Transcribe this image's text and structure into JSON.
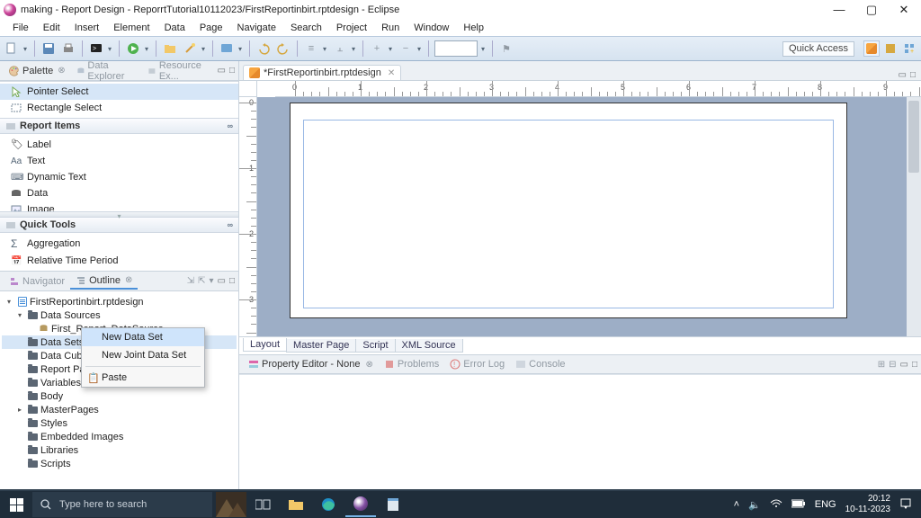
{
  "window": {
    "title": "making - Report Design - ReporrtTutorial10112023/FirstReportinbirt.rptdesign - Eclipse",
    "controls": {
      "min": "—",
      "max": "▢",
      "close": "✕"
    }
  },
  "menu": [
    "File",
    "Edit",
    "Insert",
    "Element",
    "Data",
    "Page",
    "Navigate",
    "Search",
    "Project",
    "Run",
    "Window",
    "Help"
  ],
  "toolbar": {
    "quick_access": "Quick Access"
  },
  "sidebar_views": {
    "palette": "Palette",
    "data_explorer": "Data Explorer",
    "resource_explorer": "Resource Ex..."
  },
  "palette": {
    "pointer_select": "Pointer Select",
    "rectangle_select": "Rectangle Select",
    "report_items_header": "Report Items",
    "items": [
      "Label",
      "Text",
      "Dynamic Text",
      "Data",
      "Image"
    ],
    "quick_tools_header": "Quick Tools",
    "qitems": [
      "Aggregation",
      "Relative Time Period"
    ]
  },
  "outline_tabs": {
    "navigator": "Navigator",
    "outline": "Outline"
  },
  "outline": {
    "root": "FirstReportinbirt.rptdesign",
    "data_sources": "Data Sources",
    "data_source_1": "First_Report_DataSource",
    "data_sets": "Data Sets",
    "data_cubes": "Data Cub",
    "report_params": "Report Pa",
    "variables": "Variables",
    "body": "Body",
    "master_pages": "MasterPages",
    "styles": "Styles",
    "embedded_images": "Embedded Images",
    "libraries": "Libraries",
    "scripts": "Scripts"
  },
  "context_menu": {
    "new_data_set": "New Data Set",
    "new_joint_data_set": "New Joint Data Set",
    "paste": "Paste"
  },
  "editor": {
    "tab_label": "*FirstReportinbirt.rptdesign",
    "bottom_tabs": [
      "Layout",
      "Master Page",
      "Script",
      "XML Source"
    ]
  },
  "property_views": {
    "property_editor": "Property Editor - None",
    "problems": "Problems",
    "error_log": "Error Log",
    "console": "Console"
  },
  "taskbar": {
    "search_placeholder": "Type here to search",
    "lang": "ENG",
    "time": "20:12",
    "date": "10-11-2023"
  }
}
